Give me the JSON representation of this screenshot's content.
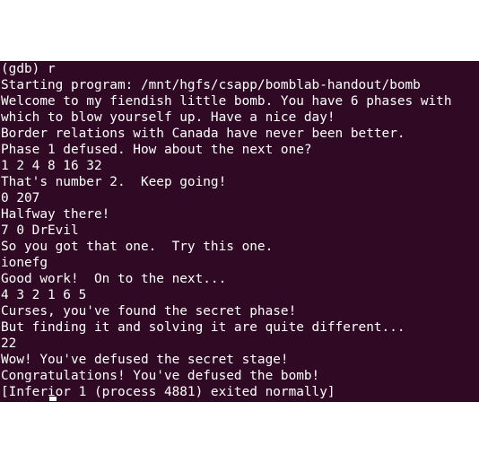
{
  "terminal": {
    "lines": [
      "(gdb) r",
      "Starting program: /mnt/hgfs/csapp/bomblab-handout/bomb",
      "Welcome to my fiendish little bomb. You have 6 phases with",
      "which to blow yourself up. Have a nice day!",
      "Border relations with Canada have never been better.",
      "Phase 1 defused. How about the next one?",
      "1 2 4 8 16 32",
      "That's number 2.  Keep going!",
      "0 207",
      "Halfway there!",
      "7 0 DrEvil",
      "So you got that one.  Try this one.",
      "ionefg",
      "Good work!  On to the next...",
      "4 3 2 1 6 5",
      "Curses, you've found the secret phase!",
      "But finding it and solving it are quite different...",
      "22",
      "Wow! You've defused the secret stage!",
      "Congratulations! You've defused the bomb!",
      "[Inferior 1 (process 4881) exited normally]"
    ],
    "colors": {
      "background": "#300a24",
      "text": "#ffffff"
    }
  }
}
